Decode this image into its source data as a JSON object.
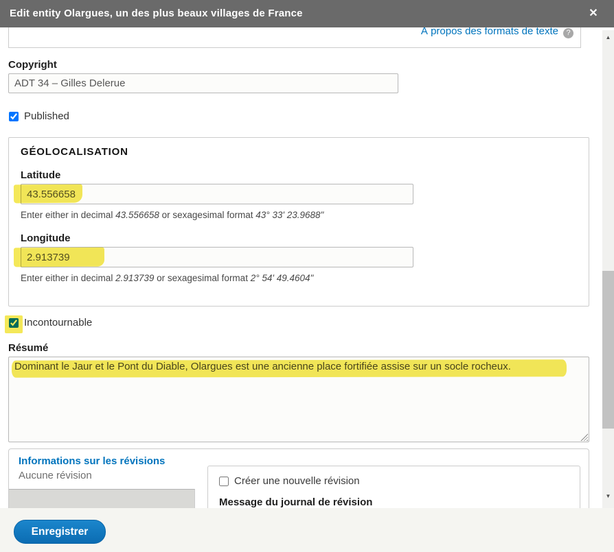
{
  "dialog": {
    "title": "Edit entity Olargues, un des plus beaux villages de France"
  },
  "icons": {
    "close": "✕",
    "info": "?",
    "scroll_up": "▲",
    "scroll_down": "▼"
  },
  "body_field": {
    "about_formats_link": "À propos des formats de texte"
  },
  "copyright": {
    "label": "Copyright",
    "value": "ADT 34 – Gilles Delerue"
  },
  "published": {
    "label": "Published",
    "checked": true
  },
  "geolocation": {
    "legend": "GÉOLOCALISATION",
    "latitude": {
      "label": "Latitude",
      "value": "43.556658",
      "help_prefix": "Enter either in decimal ",
      "help_decimal": "43.556658",
      "help_middle": " or sexagesimal format ",
      "help_sexagesimal": "43° 33' 23.9688\""
    },
    "longitude": {
      "label": "Longitude",
      "value": "2.913739",
      "help_prefix": "Enter either in decimal ",
      "help_decimal": "2.913739",
      "help_middle": " or sexagesimal format ",
      "help_sexagesimal": "2° 54' 49.4604\""
    }
  },
  "incontournable": {
    "label": "Incontournable",
    "checked": true
  },
  "resume": {
    "label": "Résumé",
    "value": "Dominant le Jaur et le Pont du Diable, Olargues est une ancienne place fortifiée assise sur un socle rocheux."
  },
  "revisions": {
    "heading": "Informations sur les révisions",
    "status": "Aucune révision",
    "new_revision_label": "Créer une nouvelle révision",
    "new_revision_checked": false,
    "log_label": "Message du journal de révision"
  },
  "footer": {
    "save_label": "Enregistrer"
  },
  "colors": {
    "header_gray": "#6a6a6a",
    "accent_blue": "#0074bd",
    "button_blue": "#0b6cb2",
    "highlight_yellow": "#f0df18"
  }
}
